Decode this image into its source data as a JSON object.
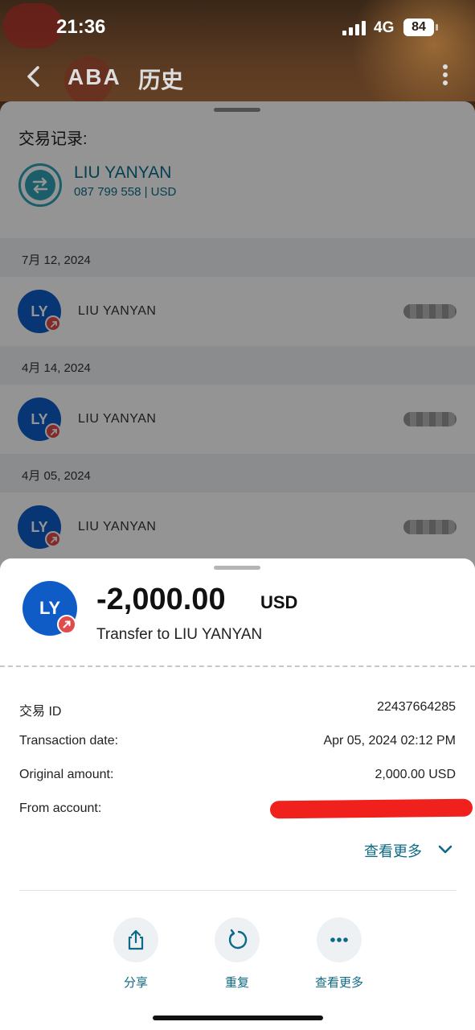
{
  "status_bar": {
    "time": "21:36",
    "network": "4G",
    "battery": "84"
  },
  "nav": {
    "brand": "ABA",
    "title": "历史"
  },
  "history": {
    "section_label": "交易记录:",
    "account_name": "LIU YANYAN",
    "account_sub": "087 799 558 | USD",
    "groups": [
      {
        "date": "7月 12, 2024",
        "avatar": "LY",
        "name": "LIU YANYAN"
      },
      {
        "date": "4月 14, 2024",
        "avatar": "LY",
        "name": "LIU YANYAN"
      },
      {
        "date": "4月 05, 2024",
        "avatar": "LY",
        "name": "LIU YANYAN"
      }
    ]
  },
  "detail": {
    "avatar": "LY",
    "amount": "-2,000.00",
    "currency": "USD",
    "description": "Transfer to LIU YANYAN",
    "fields": [
      {
        "label": "交易 ID",
        "value": "22437664285"
      },
      {
        "label": "Transaction date:",
        "value": "Apr 05, 2024 02:12 PM"
      },
      {
        "label": "Original amount:",
        "value": "2,000.00 USD"
      },
      {
        "label": "From account:",
        "value": ""
      }
    ],
    "see_more": "查看更多",
    "actions": [
      {
        "label": "分享",
        "icon": "share-icon"
      },
      {
        "label": "重复",
        "icon": "repeat-icon"
      },
      {
        "label": "查看更多",
        "icon": "more-horizontal-icon"
      }
    ]
  },
  "colors": {
    "brand_blue": "#0f5cc7",
    "link_teal": "#0d6a86",
    "badge_red": "#e14b4b"
  }
}
